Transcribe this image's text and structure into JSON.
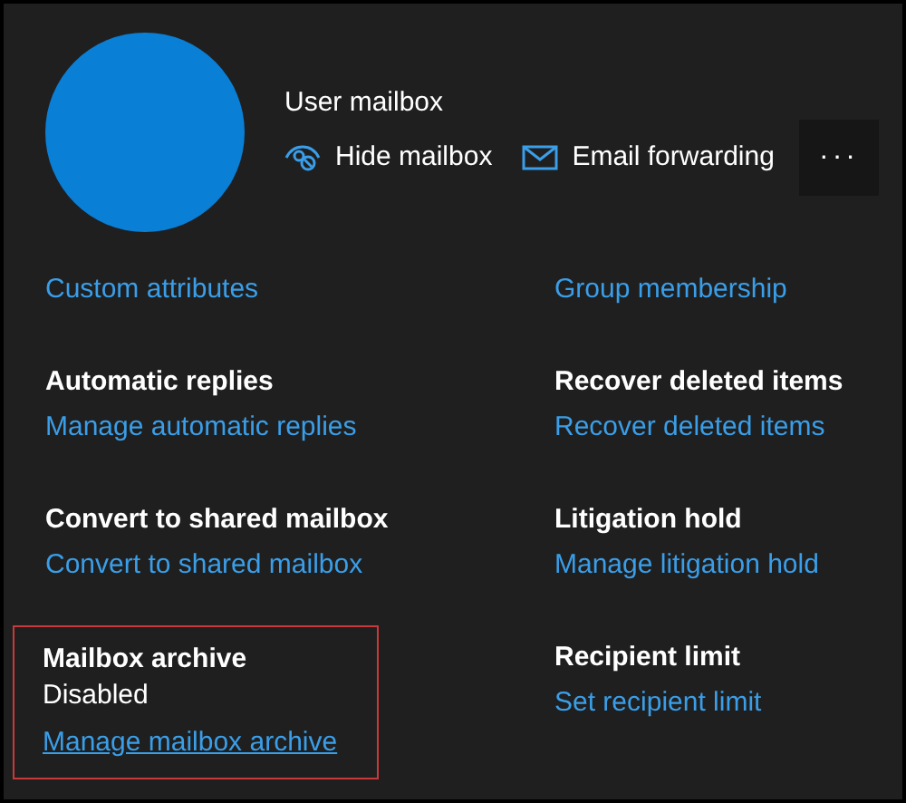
{
  "header": {
    "subtitle": "User mailbox",
    "actions": [
      {
        "kind": "hide",
        "label": "Hide mailbox"
      },
      {
        "kind": "forward",
        "label": "Email forwarding"
      }
    ],
    "more": "···"
  },
  "sections": [
    {
      "link": "Custom attributes",
      "outlined": false
    },
    {
      "link": "Group membership",
      "outlined": false
    },
    {
      "heading": "Automatic replies",
      "link": "Manage automatic replies",
      "outlined": false
    },
    {
      "heading": "Recover deleted items",
      "link": "Recover deleted items",
      "outlined": false
    },
    {
      "heading": "Convert to shared mailbox",
      "link": "Convert to shared mailbox",
      "outlined": false
    },
    {
      "heading": "Litigation hold",
      "link": "Manage litigation hold",
      "outlined": false
    },
    {
      "heading": "Mailbox archive",
      "status": "Disabled",
      "link": "Manage mailbox archive",
      "outlined": true
    },
    {
      "heading": "Recipient limit",
      "link": "Set recipient limit",
      "outlined": false
    }
  ]
}
